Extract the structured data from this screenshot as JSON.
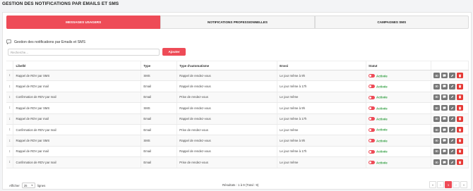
{
  "page": {
    "title": "GESTION DES NOTIFICATIONS PAR EMAILS ET SMS"
  },
  "tabs": [
    {
      "label": "MESSAGES USAGERS",
      "active": true
    },
    {
      "label": "NOTIFICATIONS PROFESSIONNELLES",
      "active": false
    },
    {
      "label": "CAMPAGNES SMS",
      "active": false
    }
  ],
  "section": {
    "title": "Gestion des notifications par Emails et SMS",
    "icon": "comment-icon"
  },
  "search": {
    "placeholder": "Recherche...",
    "value": ""
  },
  "add_button": {
    "label": "Ajouter"
  },
  "table": {
    "columns": [
      "",
      "Libellé",
      "Type",
      "Type d'automatisme",
      "Envoi",
      "Statut",
      ""
    ],
    "rows": [
      {
        "libelle": "Rappel de RDV par SMS",
        "type": "SMS",
        "auto": "Rappel de rendez-vous",
        "envoi": "Le jour même à 9h",
        "statut": "Activée"
      },
      {
        "libelle": "Rappel de RDV par mail",
        "type": "Email",
        "auto": "Rappel de rendez-vous",
        "envoi": "Le jour même à 17h",
        "statut": "Activée"
      },
      {
        "libelle": "Confirmation de RDV par mail",
        "type": "Email",
        "auto": "Prise de rendez-vous",
        "envoi": "Le jour même",
        "statut": "Activée"
      },
      {
        "libelle": "Rappel de RDV par SMS",
        "type": "SMS",
        "auto": "Rappel de rendez-vous",
        "envoi": "Le jour même à 9h",
        "statut": "Activée"
      },
      {
        "libelle": "Rappel de RDV par mail",
        "type": "Email",
        "auto": "Rappel de rendez-vous",
        "envoi": "Le jour même à 17h",
        "statut": "Activée"
      },
      {
        "libelle": "Confirmation de RDV par mail",
        "type": "Email",
        "auto": "Prise de rendez-vous",
        "envoi": "Le jour même",
        "statut": "Activée"
      },
      {
        "libelle": "Rappel de RDV par SMS",
        "type": "SMS",
        "auto": "Rappel de rendez-vous",
        "envoi": "Le jour même à 9h",
        "statut": "Activée"
      },
      {
        "libelle": "Rappel de RDV par mail",
        "type": "Email",
        "auto": "Rappel de rendez-vous",
        "envoi": "Le jour même à 17h",
        "statut": "Activée"
      },
      {
        "libelle": "Confirmation de RDV par mail",
        "type": "Email",
        "auto": "Prise de rendez-vous",
        "envoi": "Le jour même",
        "statut": "Activée"
      }
    ],
    "drag_glyph": "↕",
    "row_actions": [
      "eye-icon",
      "comment-icon",
      "edit-icon",
      "trash-icon"
    ]
  },
  "footer": {
    "show_label": "Afficher",
    "per_page": "25",
    "lines_label": "lignes",
    "results": "Résultats : 1 à 9 (Total : 9)",
    "pager": {
      "first": "«",
      "prev": "‹",
      "current": "1",
      "next": "›",
      "last": "»"
    }
  },
  "colors": {
    "accent": "#ee4b57",
    "active_status": "#2e9c3e",
    "action_gray": "#777777",
    "delete_red": "#e53935"
  }
}
